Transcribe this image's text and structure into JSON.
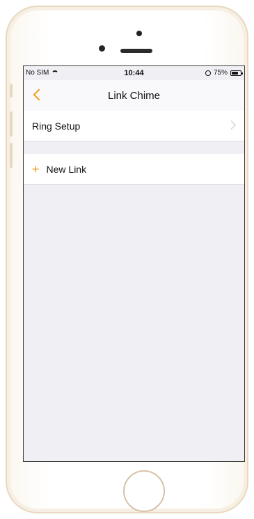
{
  "status_bar": {
    "carrier": "No SIM",
    "time": "10:44",
    "battery_percent": 75,
    "battery_text": "75%"
  },
  "nav": {
    "title": "Link Chime"
  },
  "rows": [
    {
      "label": "Ring Setup"
    }
  ],
  "actions": {
    "new_link_label": "New Link"
  },
  "colors": {
    "accent": "#f29a1a",
    "background": "#efeff4"
  },
  "icons": {
    "back": "back-chevron-icon",
    "disclosure": "chevron-right-icon",
    "plus": "plus-icon",
    "wifi": "wifi-icon",
    "battery": "battery-icon"
  }
}
